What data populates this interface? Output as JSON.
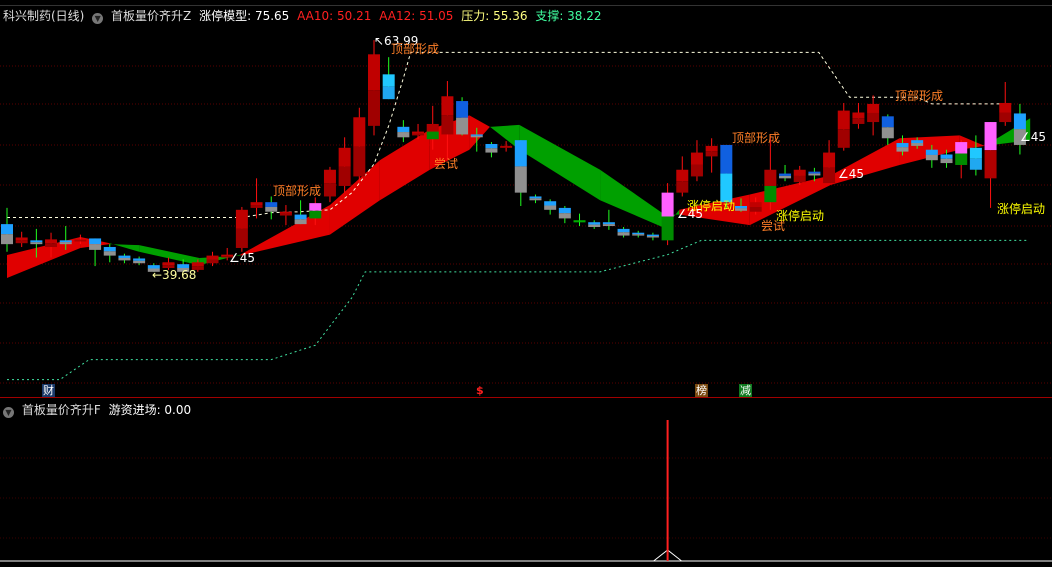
{
  "header": {
    "stock": "科兴制药(日线)",
    "indicator": "首板量价齐升Z",
    "model_label": "涨停模型: 75.65",
    "aa10_label": "AA10: 50.21",
    "aa12_label": "AA12: 51.05",
    "pressure_label": "压力: 55.36",
    "support_label": "支撑: 38.22"
  },
  "sub_header": {
    "indicator": "首板量价齐升F",
    "value_label": "游资进场: 0.00"
  },
  "colors": {
    "up": "#c00000",
    "ribbon_up": "#e00000",
    "ribbon_down": "#00a000",
    "resistance": "#ffffe0",
    "support": "#40e0a0",
    "aa10": "#ff2020",
    "pressure": "#ffff80",
    "support_text": "#40ffa0"
  },
  "annotations": {
    "high": "↖63.99",
    "low": "←39.68",
    "top1": "顶部形成",
    "top2": "顶部形成",
    "top3": "顶部形成",
    "top4": "顶部形成",
    "try1": "尝试",
    "try2": "尝试",
    "zt1": "涨停启动",
    "zt2": "涨停启动",
    "zt3": "涨停启动",
    "a1": "∠45",
    "a2": "∠45",
    "a3": "∠45",
    "a4": "∠45"
  },
  "markers": {
    "cai": "财",
    "dollar": "$",
    "bang": "榜",
    "jian": "减"
  },
  "chart_data": {
    "type": "candlestick",
    "title": "科兴制药(日线)",
    "price_high": 63.99,
    "price_low": 39.68,
    "candles": [
      {
        "o": 44.7,
        "h": 46.4,
        "l": 41.8,
        "c": 42.6,
        "t": "blue"
      },
      {
        "o": 42.7,
        "h": 43.9,
        "l": 42.3,
        "c": 43.3,
        "t": "red"
      },
      {
        "o": 43.0,
        "h": 44.2,
        "l": 41.2,
        "c": 42.6,
        "t": "blue"
      },
      {
        "o": 42.3,
        "h": 43.8,
        "l": 41.2,
        "c": 43.1,
        "t": "red"
      },
      {
        "o": 43.0,
        "h": 44.5,
        "l": 42.0,
        "c": 42.6,
        "t": "blue"
      },
      {
        "o": 42.9,
        "h": 43.6,
        "l": 42.6,
        "c": 43.1,
        "t": "red"
      },
      {
        "o": 43.2,
        "h": 43.2,
        "l": 40.3,
        "c": 42.0,
        "t": "blue"
      },
      {
        "o": 42.3,
        "h": 42.6,
        "l": 40.7,
        "c": 41.4,
        "t": "blue"
      },
      {
        "o": 41.4,
        "h": 41.6,
        "l": 40.6,
        "c": 40.9,
        "t": "blue"
      },
      {
        "o": 41.1,
        "h": 41.3,
        "l": 40.4,
        "c": 40.6,
        "t": "blue"
      },
      {
        "o": 40.4,
        "h": 40.6,
        "l": 39.7,
        "c": 39.7,
        "t": "blue"
      },
      {
        "o": 40.1,
        "h": 41.2,
        "l": 39.9,
        "c": 40.7,
        "t": "red"
      },
      {
        "o": 40.5,
        "h": 41.0,
        "l": 39.7,
        "c": 39.7,
        "t": "blue"
      },
      {
        "o": 39.9,
        "h": 41.0,
        "l": 39.7,
        "c": 40.7,
        "t": "red"
      },
      {
        "o": 40.6,
        "h": 41.8,
        "l": 40.3,
        "c": 41.4,
        "t": "red"
      },
      {
        "o": 41.2,
        "h": 42.2,
        "l": 40.9,
        "c": 41.5,
        "t": "red"
      },
      {
        "o": 42.2,
        "h": 46.5,
        "l": 41.8,
        "c": 46.2,
        "t": "red"
      },
      {
        "o": 46.4,
        "h": 49.5,
        "l": 45.3,
        "c": 47.0,
        "t": "red"
      },
      {
        "o": 47.0,
        "h": 47.6,
        "l": 45.2,
        "c": 46.0,
        "t": "bluedark"
      },
      {
        "o": 45.6,
        "h": 46.7,
        "l": 44.6,
        "c": 46.0,
        "t": "red"
      },
      {
        "o": 45.7,
        "h": 47.2,
        "l": 44.7,
        "c": 44.7,
        "t": "blue"
      },
      {
        "o": 46.9,
        "h": 47.5,
        "l": 44.6,
        "c": 45.3,
        "t": "pink"
      },
      {
        "o": 47.6,
        "h": 50.7,
        "l": 47.0,
        "c": 50.4,
        "t": "red"
      },
      {
        "o": 48.7,
        "h": 53.8,
        "l": 48.0,
        "c": 52.7,
        "t": "red"
      },
      {
        "o": 49.7,
        "h": 56.9,
        "l": 49.0,
        "c": 55.9,
        "t": "red"
      },
      {
        "o": 55.0,
        "h": 63.99,
        "l": 54.0,
        "c": 62.5,
        "t": "red"
      },
      {
        "o": 60.4,
        "h": 62.2,
        "l": 57.8,
        "c": 57.8,
        "t": "cyan"
      },
      {
        "o": 54.9,
        "h": 55.6,
        "l": 53.3,
        "c": 53.8,
        "t": "blue"
      },
      {
        "o": 54.0,
        "h": 55.2,
        "l": 53.6,
        "c": 54.4,
        "t": "red"
      },
      {
        "o": 55.2,
        "h": 57.1,
        "l": 52.5,
        "c": 53.6,
        "t": "redgreen"
      },
      {
        "o": 54.1,
        "h": 59.7,
        "l": 51.4,
        "c": 58.1,
        "t": "red"
      },
      {
        "o": 57.6,
        "h": 58.0,
        "l": 54.0,
        "c": 54.1,
        "t": "bluedark"
      },
      {
        "o": 54.1,
        "h": 54.8,
        "l": 52.3,
        "c": 53.8,
        "t": "blue"
      },
      {
        "o": 53.1,
        "h": 53.3,
        "l": 51.7,
        "c": 52.2,
        "t": "blue"
      },
      {
        "o": 52.9,
        "h": 53.4,
        "l": 52.3,
        "c": 52.9,
        "t": "red"
      },
      {
        "o": 53.5,
        "h": 53.5,
        "l": 46.6,
        "c": 48.0,
        "t": "blue"
      },
      {
        "o": 47.6,
        "h": 47.8,
        "l": 46.9,
        "c": 47.2,
        "t": "blue"
      },
      {
        "o": 47.1,
        "h": 47.3,
        "l": 45.7,
        "c": 46.2,
        "t": "blue"
      },
      {
        "o": 46.4,
        "h": 46.6,
        "l": 44.8,
        "c": 45.3,
        "t": "blue"
      },
      {
        "o": 45.1,
        "h": 45.8,
        "l": 44.5,
        "c": 45.1,
        "t": "green"
      },
      {
        "o": 44.9,
        "h": 45.1,
        "l": 44.2,
        "c": 44.4,
        "t": "blue"
      },
      {
        "o": 44.9,
        "h": 46.2,
        "l": 44.1,
        "c": 44.5,
        "t": "blue"
      },
      {
        "o": 44.2,
        "h": 44.4,
        "l": 43.3,
        "c": 43.5,
        "t": "blue"
      },
      {
        "o": 43.8,
        "h": 44.0,
        "l": 43.3,
        "c": 43.5,
        "t": "blue"
      },
      {
        "o": 43.6,
        "h": 43.8,
        "l": 43.0,
        "c": 43.3,
        "t": "blue"
      },
      {
        "o": 43.0,
        "h": 49.0,
        "l": 42.5,
        "c": 48.0,
        "t": "pink"
      },
      {
        "o": 48.0,
        "h": 51.8,
        "l": 47.6,
        "c": 50.4,
        "t": "red"
      },
      {
        "o": 49.7,
        "h": 53.5,
        "l": 49.2,
        "c": 52.2,
        "t": "red"
      },
      {
        "o": 51.8,
        "h": 53.7,
        "l": 50.1,
        "c": 52.9,
        "t": "red"
      },
      {
        "o": 53.0,
        "h": 53.0,
        "l": 46.4,
        "c": 47.0,
        "t": "bluetall"
      },
      {
        "o": 46.6,
        "h": 47.4,
        "l": 46.0,
        "c": 46.1,
        "t": "blue"
      },
      {
        "o": 46.0,
        "h": 47.5,
        "l": 45.7,
        "c": 47.0,
        "t": "red"
      },
      {
        "o": 47.0,
        "h": 54.0,
        "l": 46.2,
        "c": 50.4,
        "t": "redgreen"
      },
      {
        "o": 50.0,
        "h": 50.9,
        "l": 49.2,
        "c": 49.5,
        "t": "bluedark"
      },
      {
        "o": 49.1,
        "h": 50.8,
        "l": 48.8,
        "c": 50.4,
        "t": "red"
      },
      {
        "o": 50.2,
        "h": 50.6,
        "l": 49.2,
        "c": 49.8,
        "t": "bluedark"
      },
      {
        "o": 49.0,
        "h": 53.5,
        "l": 49.0,
        "c": 52.2,
        "t": "red"
      },
      {
        "o": 52.7,
        "h": 57.4,
        "l": 52.4,
        "c": 56.6,
        "t": "red"
      },
      {
        "o": 55.2,
        "h": 57.4,
        "l": 54.7,
        "c": 56.4,
        "t": "red"
      },
      {
        "o": 55.4,
        "h": 58.2,
        "l": 54.0,
        "c": 57.3,
        "t": "red"
      },
      {
        "o": 56.0,
        "h": 56.2,
        "l": 53.0,
        "c": 53.7,
        "t": "bluedark"
      },
      {
        "o": 53.2,
        "h": 54.0,
        "l": 51.9,
        "c": 52.3,
        "t": "blue"
      },
      {
        "o": 53.5,
        "h": 53.8,
        "l": 52.6,
        "c": 52.9,
        "t": "blue"
      },
      {
        "o": 52.5,
        "h": 53.0,
        "l": 50.6,
        "c": 51.4,
        "t": "blue"
      },
      {
        "o": 52.0,
        "h": 52.5,
        "l": 50.6,
        "c": 51.1,
        "t": "blue"
      },
      {
        "o": 50.9,
        "h": 53.5,
        "l": 49.5,
        "c": 53.3,
        "t": "pink"
      },
      {
        "o": 52.7,
        "h": 54.0,
        "l": 49.8,
        "c": 50.4,
        "t": "cyan"
      },
      {
        "o": 49.5,
        "h": 55.4,
        "l": 46.4,
        "c": 55.4,
        "t": "pinkred"
      },
      {
        "o": 55.4,
        "h": 59.6,
        "l": 55.0,
        "c": 57.4,
        "t": "red"
      },
      {
        "o": 56.3,
        "h": 57.3,
        "l": 52.0,
        "c": 53.0,
        "t": "blue"
      }
    ],
    "ribbon": {
      "x": [
        0,
        5,
        7,
        9,
        13.1,
        15.9,
        22,
        25.4,
        28.8,
        31.5,
        32.9,
        34.9,
        40.4,
        44.8,
        45.8,
        50.6,
        56.1,
        60.8,
        64.9,
        66.6,
        69.7
      ],
      "fast": [
        41.46,
        43.35,
        42.7,
        41.8,
        40.4,
        41.5,
        46.7,
        51.4,
        54.6,
        56.1,
        54.9,
        52.5,
        47.2,
        44.3,
        46.2,
        47.8,
        49.8,
        53.7,
        54.0,
        52.9,
        53.5
      ],
      "slow": [
        39.05,
        42.2,
        42.6,
        42.5,
        41.15,
        41.4,
        43.6,
        47.2,
        50.4,
        52.5,
        54.9,
        55.1,
        50.4,
        45.7,
        45.7,
        44.6,
        48.8,
        50.9,
        52.5,
        52.9,
        55.8
      ]
    },
    "resistance_line": [
      [
        0,
        45.4
      ],
      [
        15.6,
        45.4
      ],
      [
        16,
        45.4
      ],
      [
        18,
        45.9
      ],
      [
        20,
        46.0
      ],
      [
        22,
        46.2
      ],
      [
        23.5,
        48
      ],
      [
        25,
        51
      ],
      [
        26,
        55
      ],
      [
        27,
        60
      ],
      [
        27.5,
        62.7
      ],
      [
        55.3,
        62.7
      ],
      [
        57.4,
        58.0
      ],
      [
        62,
        58.0
      ],
      [
        63,
        57.3
      ],
      [
        68.3,
        57.3
      ]
    ],
    "support_line": [
      [
        0,
        28.4
      ],
      [
        3.6,
        28.4
      ],
      [
        5.6,
        30.5
      ],
      [
        18,
        30.5
      ],
      [
        21,
        32
      ],
      [
        23.5,
        37
      ],
      [
        24.4,
        39.7
      ],
      [
        40.4,
        39.7
      ],
      [
        45,
        41.5
      ],
      [
        47.3,
        43.0
      ],
      [
        69.6,
        43.0
      ]
    ],
    "sub_series": {
      "name": "游资进场",
      "spike_index": 45,
      "value": 0.0
    }
  }
}
